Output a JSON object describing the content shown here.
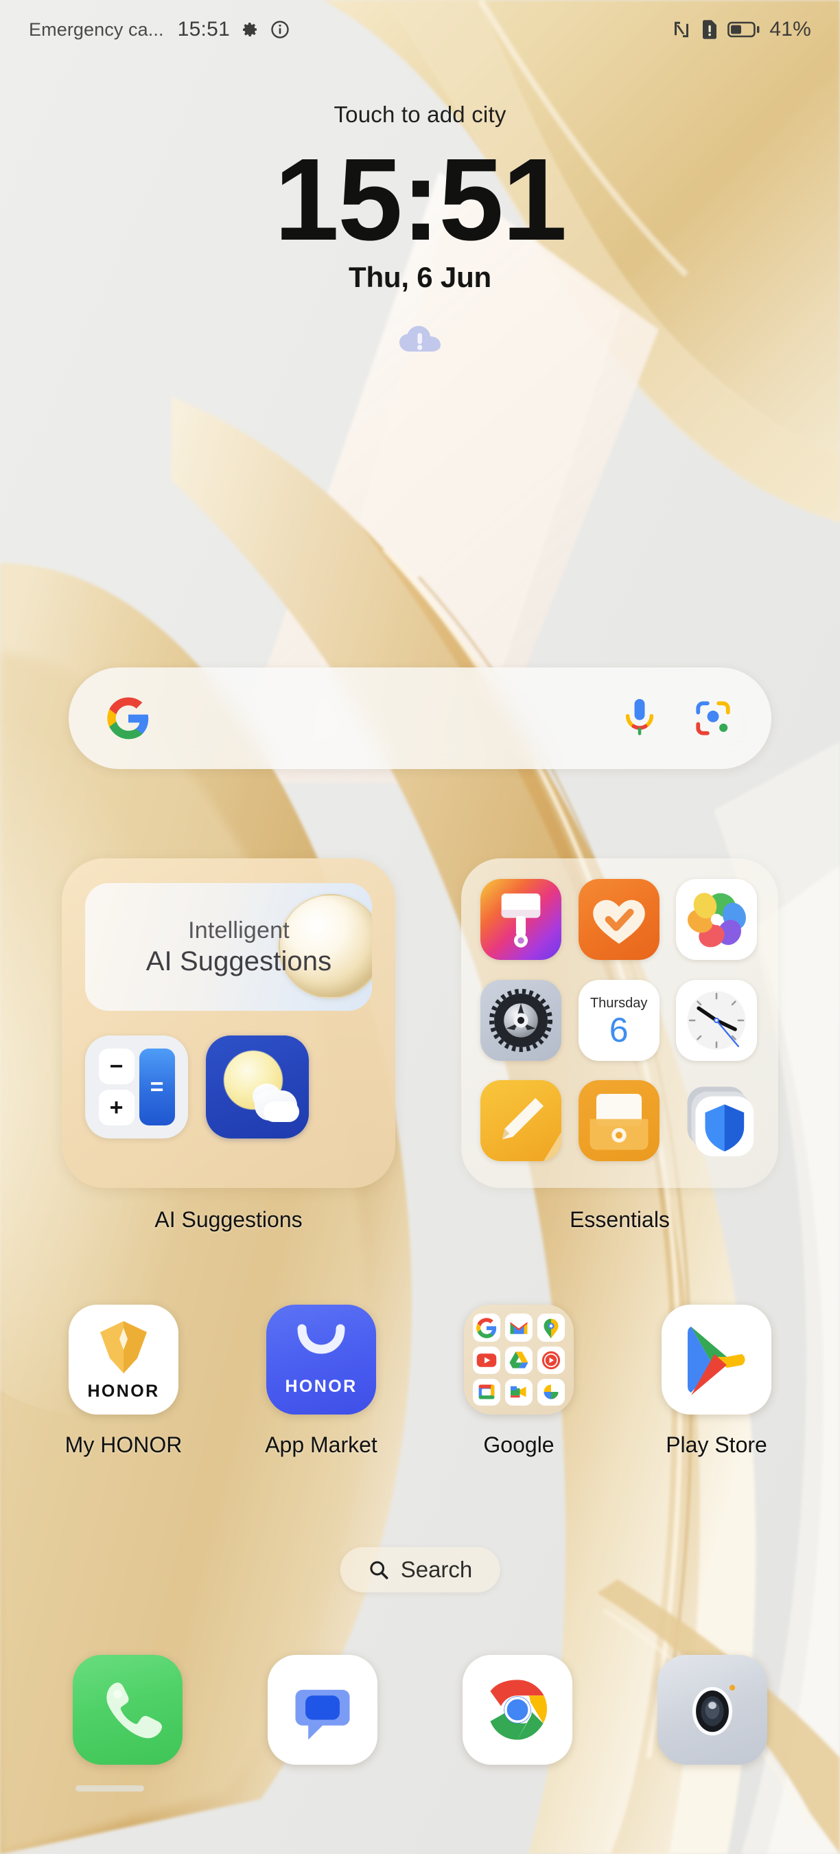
{
  "status_bar": {
    "carrier": "Emergency ca...",
    "time": "15:51",
    "icons": [
      "gear-icon",
      "info-icon",
      "nfc-icon",
      "sim-alert-icon",
      "battery-icon"
    ],
    "battery_percent": "41%",
    "battery_level": 41
  },
  "clock_widget": {
    "city_prompt": "Touch to add city",
    "time": "15:51",
    "date": "Thu, 6 Jun",
    "weather_icon": "cloud-alert-icon"
  },
  "google_search": {
    "logo": "google-g-icon",
    "placeholder": "",
    "value": "",
    "mic_icon": "microphone-icon",
    "lens_icon": "google-lens-icon"
  },
  "folders": [
    {
      "name": "ai-suggestions",
      "label": "AI Suggestions",
      "card": {
        "line1": "Intelligent",
        "line2": "AI Suggestions"
      },
      "apps": [
        {
          "name": "calculator",
          "icon": "calculator-icon",
          "keys": [
            "−",
            "+",
            "="
          ]
        },
        {
          "name": "weather",
          "icon": "weather-icon"
        }
      ]
    },
    {
      "name": "essentials",
      "label": "Essentials",
      "apps": [
        {
          "name": "themes",
          "icon": "paintbrush-icon"
        },
        {
          "name": "health",
          "icon": "heart-check-icon"
        },
        {
          "name": "gallery",
          "icon": "pinwheel-icon"
        },
        {
          "name": "settings",
          "icon": "gear-icon"
        },
        {
          "name": "calendar",
          "icon": "calendar-icon",
          "weekday": "Thursday",
          "day": "6"
        },
        {
          "name": "clock",
          "icon": "analog-clock-icon"
        },
        {
          "name": "notes",
          "icon": "pencil-note-icon"
        },
        {
          "name": "files",
          "icon": "folder-icon"
        },
        {
          "name": "security",
          "icon": "shield-icon"
        }
      ]
    }
  ],
  "app_row": [
    {
      "name": "my-honor",
      "label": "My HONOR",
      "icon": "honor-diamond-icon",
      "brand": "HONOR"
    },
    {
      "name": "app-market",
      "label": "App Market",
      "icon": "shopping-bag-icon",
      "brand": "HONOR"
    },
    {
      "name": "google-folder",
      "label": "Google",
      "icon": "google-folder-icon",
      "apps": [
        "google",
        "gmail",
        "maps",
        "youtube",
        "drive",
        "youtube-music",
        "calendar",
        "meet",
        "photos"
      ]
    },
    {
      "name": "play-store",
      "label": "Play Store",
      "icon": "play-store-icon"
    }
  ],
  "search_pill": {
    "label": "Search",
    "icon": "magnifier-icon"
  },
  "dock": [
    {
      "name": "phone",
      "icon": "phone-icon"
    },
    {
      "name": "messages",
      "icon": "speech-bubble-icon"
    },
    {
      "name": "chrome",
      "icon": "chrome-icon"
    },
    {
      "name": "camera",
      "icon": "camera-lens-icon"
    }
  ],
  "colors": {
    "wallpaper_light": "#ececeb",
    "wallpaper_gold": "#e2c489",
    "accent_blue": "#4285f4",
    "accent_green": "#34a853",
    "accent_red": "#ea4335",
    "accent_yellow": "#fbbc05",
    "honor_blue": "#4a5ef0",
    "folder_ai_bg": "#f2dbb4"
  }
}
